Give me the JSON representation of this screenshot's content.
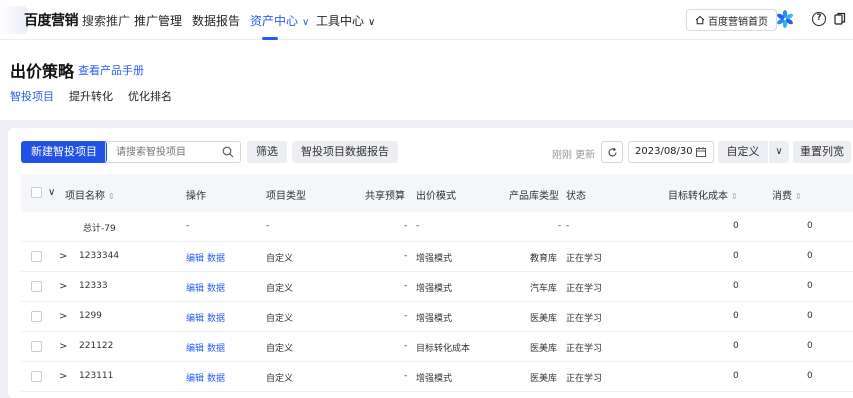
{
  "topnav": {
    "logo_text": "百度营销",
    "logo_sub": "搜索推广",
    "items": [
      {
        "label": "推广管理"
      },
      {
        "label": "数据报告"
      },
      {
        "label": "资产中心",
        "chevron": "∨"
      },
      {
        "label": "工具中心",
        "chevron": "∨"
      }
    ],
    "home_label": "百度营销首页",
    "help_label": "?"
  },
  "page": {
    "title": "出价策略",
    "manual_link": "查看产品手册",
    "tabs": [
      "智投项目",
      "提升转化",
      "优化排名"
    ]
  },
  "toolbar": {
    "new_button": "新建智投项目",
    "search_placeholder": "请搜索智投项目",
    "filter_button": "筛选",
    "report_button": "智投项目数据报告",
    "updated_text": "刚刚 更新",
    "date": "2023/08/30",
    "custom_button": "自定义",
    "custom_chevron": "∨",
    "reset_button": "重置列宽"
  },
  "table": {
    "headers": {
      "select_chevron": "∨",
      "name": "项目名称",
      "actions": "操作",
      "type": "项目类型",
      "budget": "共享预算",
      "bid_mode": "出价模式",
      "product_type": "产品库类型",
      "status": "状态",
      "target_cost": "目标转化成本",
      "spend": "消费",
      "sort_glyph": "⇕"
    },
    "total_row": {
      "name": "总计-79",
      "actions": "-",
      "type": "-",
      "budget": "-",
      "bid_mode": "-",
      "product_type": "-",
      "status": "-",
      "target_cost": "0",
      "spend": "0"
    },
    "rows": [
      {
        "name": "1233344",
        "edit": "编辑",
        "data": "数据",
        "type": "自定义",
        "budget": "-",
        "bid_mode": "增强模式",
        "product_type": "教育库",
        "status": "正在学习",
        "target_cost": "0",
        "spend": "0"
      },
      {
        "name": "12333",
        "edit": "编辑",
        "data": "数据",
        "type": "自定义",
        "budget": "-",
        "bid_mode": "增强模式",
        "product_type": "汽车库",
        "status": "正在学习",
        "target_cost": "0",
        "spend": "0"
      },
      {
        "name": "1299",
        "edit": "编辑",
        "data": "数据",
        "type": "自定义",
        "budget": "-",
        "bid_mode": "增强模式",
        "product_type": "医美库",
        "status": "正在学习",
        "target_cost": "0",
        "spend": "0"
      },
      {
        "name": "221122",
        "edit": "编辑",
        "data": "数据",
        "type": "自定义",
        "budget": "-",
        "bid_mode": "目标转化成本",
        "product_type": "医美库",
        "status": "正在学习",
        "target_cost": "0",
        "spend": "0"
      },
      {
        "name": "123111",
        "edit": "编辑",
        "data": "数据",
        "type": "自定义",
        "budget": "-",
        "bid_mode": "增强模式",
        "product_type": "医美库",
        "status": "正在学习",
        "target_cost": "0",
        "spend": "0"
      }
    ],
    "expand_glyph": ">"
  },
  "colors": {
    "accent": "#2a5cf5",
    "primary_button": "#2251e6",
    "header_bg": "#f4f6fa",
    "page_bg": "#eef0f5"
  }
}
